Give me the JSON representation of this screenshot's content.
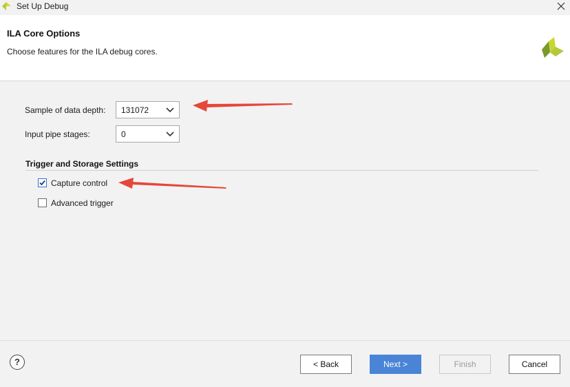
{
  "window": {
    "title": "Set Up Debug"
  },
  "header": {
    "title": "ILA Core Options",
    "subtitle": "Choose features for the ILA debug cores."
  },
  "form": {
    "sample_depth": {
      "label": "Sample of data depth:",
      "value": "131072"
    },
    "pipe_stages": {
      "label": "Input pipe stages:",
      "value": "0"
    }
  },
  "trigger_section": {
    "title": "Trigger and Storage Settings",
    "capture_control": {
      "label": "Capture control",
      "checked": true
    },
    "advanced_trigger": {
      "label": "Advanced trigger",
      "checked": false
    }
  },
  "footer": {
    "help_label": "?",
    "back_label": "< Back",
    "next_label": "Next >",
    "finish_label": "Finish",
    "cancel_label": "Cancel"
  },
  "colors": {
    "primary_button": "#4a84d6",
    "annotation_arrow": "#e5473a",
    "logo_green": "#9ac23c"
  },
  "icons": [
    "vivado-logo-icon",
    "close-icon",
    "chevron-down-icon",
    "checkmark-icon",
    "help-icon",
    "annotation-arrow"
  ]
}
